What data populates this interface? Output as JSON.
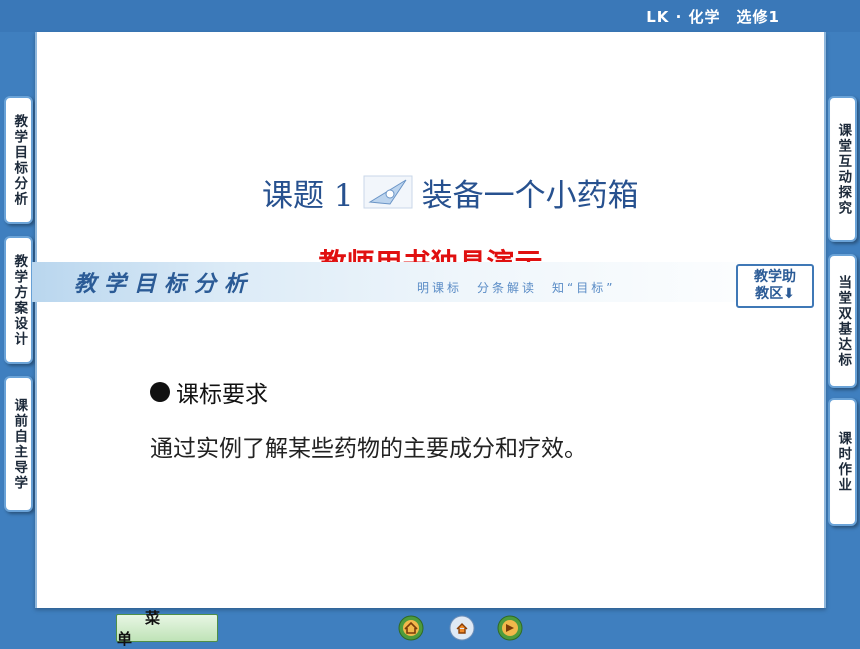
{
  "header": {
    "course": "LK · 化学　选修1"
  },
  "left_tabs": [
    {
      "label": "教学目标分析"
    },
    {
      "label": "教学方案设计"
    },
    {
      "label": "课前自主导学"
    }
  ],
  "right_tabs": [
    {
      "label": "课堂互动探究"
    },
    {
      "label": "当堂双基达标"
    },
    {
      "label": "课时作业"
    }
  ],
  "slide": {
    "title_prefix": "课题 1",
    "title_main": "装备一个小药箱",
    "subtitle": "教师用书独具演示",
    "banner_title": "教学目标分析",
    "banner_sub": "明课标　分条解读　知“目标”",
    "helper_line1": "教学助",
    "helper_line2": "教区⬇",
    "requirement_heading": "课标要求",
    "requirement_text": "通过实例了解某些药物的主要成分和疗效。"
  },
  "footer": {
    "menu_label": "菜单",
    "nav": [
      "home-icon",
      "back-icon",
      "forward-icon"
    ]
  },
  "colors": {
    "background": "#3f7fbf",
    "title": "#27518f",
    "subtitle": "#e01010"
  }
}
